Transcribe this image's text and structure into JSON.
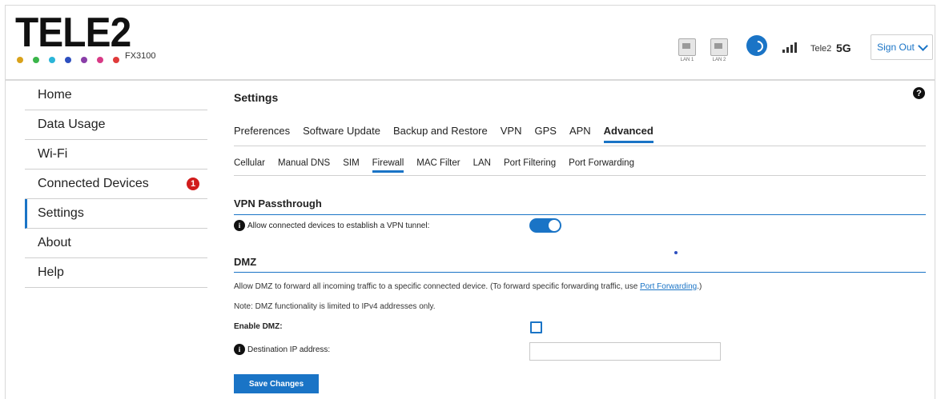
{
  "header": {
    "logo": "TELE2",
    "model": "FX3100",
    "logo_dot_colors": [
      "#d9a21b",
      "#3ab54a",
      "#2bb5d8",
      "#2d4fbf",
      "#8a3ea8",
      "#d83a86",
      "#e03a3a"
    ],
    "lan_ports": [
      {
        "label": "LAN 1"
      },
      {
        "label": "LAN 2"
      }
    ],
    "wifi_icon": "wifi-icon",
    "signal_icon": "signal-bars-icon",
    "carrier": "Tele2",
    "network": "5G",
    "signout_label": "Sign Out"
  },
  "sidebar": {
    "items": [
      {
        "label": "Home"
      },
      {
        "label": "Data Usage"
      },
      {
        "label": "Wi-Fi"
      },
      {
        "label": "Connected Devices",
        "badge": "1"
      },
      {
        "label": "Settings",
        "active": true
      },
      {
        "label": "About"
      },
      {
        "label": "Help"
      }
    ]
  },
  "main": {
    "title": "Settings",
    "help_icon": "?",
    "tabs": [
      {
        "label": "Preferences"
      },
      {
        "label": "Software Update"
      },
      {
        "label": "Backup and Restore"
      },
      {
        "label": "VPN"
      },
      {
        "label": "GPS"
      },
      {
        "label": "APN"
      },
      {
        "label": "Advanced",
        "active": true
      }
    ],
    "subtabs": [
      {
        "label": "Cellular"
      },
      {
        "label": "Manual DNS"
      },
      {
        "label": "SIM"
      },
      {
        "label": "Firewall",
        "active": true
      },
      {
        "label": "MAC Filter"
      },
      {
        "label": "LAN"
      },
      {
        "label": "Port Filtering"
      },
      {
        "label": "Port Forwarding"
      }
    ],
    "vpn": {
      "title": "VPN Passthrough",
      "allow_label": "Allow connected devices to establish a VPN tunnel:",
      "toggle_on": true
    },
    "dmz": {
      "title": "DMZ",
      "description_pre": "Allow DMZ to forward all incoming traffic to a specific connected device. (To forward specific forwarding traffic, use ",
      "description_link": "Port Forwarding",
      "description_post": ".)",
      "note": "Note: DMZ functionality is limited to IPv4 addresses only.",
      "enable_label": "Enable DMZ:",
      "enabled": false,
      "dest_label": "Destination IP address:",
      "dest_value": ""
    },
    "save_label": "Save Changes"
  },
  "colors": {
    "accent": "#1a74c6",
    "badge": "#d11c1c"
  }
}
